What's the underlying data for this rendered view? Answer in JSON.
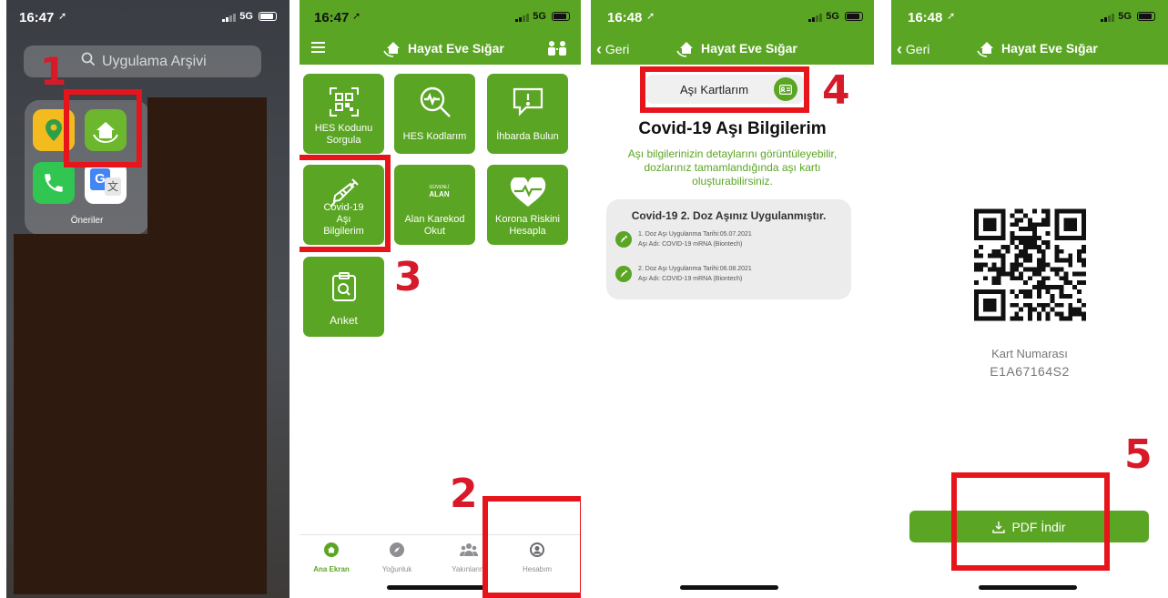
{
  "panel1": {
    "status": {
      "time": "16:47",
      "network": "5G"
    },
    "search_placeholder": "Uygulama Arşivi",
    "folder_label": "Öneriler",
    "step_number": "1"
  },
  "panel2": {
    "status": {
      "time": "16:47",
      "network": "5G"
    },
    "header_title": "Hayat Eve Sığar",
    "tiles": [
      {
        "label": "HES Kodunu Sorgula"
      },
      {
        "label": "HES Kodlarım"
      },
      {
        "label": "İhbarda Bulun"
      },
      {
        "label": "Covid-19 Aşı Bilgilerim"
      },
      {
        "label": "Alan Karekod Okut",
        "badge_top": "GÜVENLİ",
        "badge_bottom": "ALAN"
      },
      {
        "label": "Korona Riskini Hesapla"
      },
      {
        "label": "Anket"
      }
    ],
    "tabs": [
      {
        "label": "Ana Ekran"
      },
      {
        "label": "Yoğunluk"
      },
      {
        "label": "Yakınlarım"
      },
      {
        "label": "Hesabım"
      }
    ],
    "step_number_2": "2",
    "step_number_3": "3"
  },
  "panel3": {
    "status": {
      "time": "16:48",
      "network": "5G"
    },
    "back_label": "Geri",
    "header_title": "Hayat Eve Sığar",
    "cards_button": "Aşı Kartlarım",
    "title": "Covid-19 Aşı Bilgilerim",
    "description": "Aşı bilgilerinizin detaylarını görüntüleyebilir, dozlarınız tamamlandığında aşı kartı oluşturabilirsiniz.",
    "dose_summary": "Covid-19 2. Doz Aşınız Uygulanmıştır.",
    "doses": [
      {
        "date_line": "1. Doz Aşı Uygulanma Tarihi:05.07.2021",
        "name_line": "Aşı Adı: COVID-19 mRNA (Biontech)"
      },
      {
        "date_line": "2. Doz Aşı Uygulanma Tarihi:06.08.2021",
        "name_line": "Aşı Adı: COVID-19 mRNA (Biontech)"
      }
    ],
    "step_number": "4"
  },
  "panel4": {
    "status": {
      "time": "16:48",
      "network": "5G"
    },
    "back_label": "Geri",
    "header_title": "Hayat Eve Sığar",
    "card_number_label": "Kart Numarası",
    "card_number": "E1A67164S2",
    "pdf_button": "PDF İndir",
    "step_number": "5"
  },
  "colors": {
    "brand_green": "#5ba524",
    "annotation_red": "#e8141c",
    "step_red": "#d71a2a"
  }
}
